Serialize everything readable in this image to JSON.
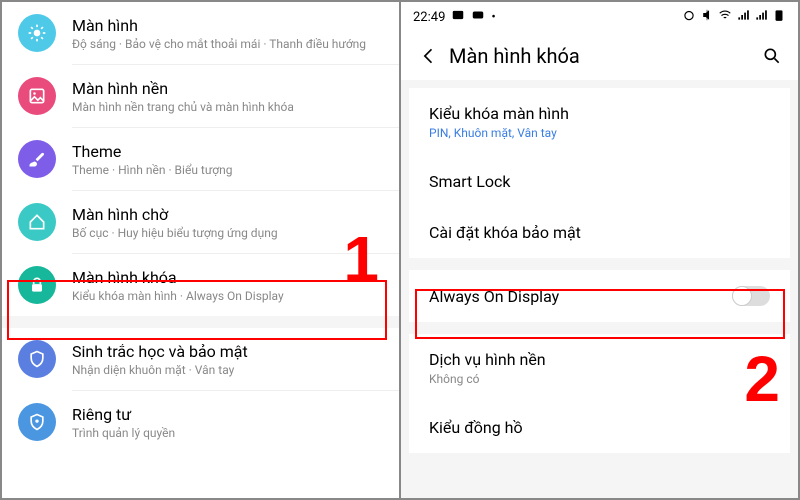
{
  "left": {
    "items": [
      {
        "title": "Màn hình",
        "sub": "Độ sáng · Bảo vệ cho mắt thoải mái · Thanh điều hướng",
        "iconColor": "#4EC9E8"
      },
      {
        "title": "Màn hình nền",
        "sub": "Màn hình nền trang chủ và màn hình khóa",
        "iconColor": "#E84B7C"
      },
      {
        "title": "Theme",
        "sub": "Theme · Hình nền · Biểu tượng",
        "iconColor": "#7E5DE8"
      },
      {
        "title": "Màn hình chờ",
        "sub": "Bố cục · Huy hiệu biểu tượng ứng dụng",
        "iconColor": "#3AC9C4"
      },
      {
        "title": "Màn hình khóa",
        "sub": "Kiểu khóa màn hình · Always On Display",
        "iconColor": "#16B79A"
      },
      {
        "title": "Sinh trắc học và bảo mật",
        "sub": "Nhận diện khuôn mặt · Vân tay",
        "iconColor": "#5A7FE0"
      },
      {
        "title": "Riêng tư",
        "sub": "Trình quản lý quyền",
        "iconColor": "#4A96E0"
      }
    ]
  },
  "right": {
    "status": {
      "time": "22:49"
    },
    "header": "Màn hình khóa",
    "group1": [
      {
        "title": "Kiểu khóa màn hình",
        "sub": "PIN, Khuôn mặt, Vân tay",
        "blue": true
      },
      {
        "title": "Smart Lock"
      },
      {
        "title": "Cài đặt khóa bảo mật"
      }
    ],
    "aod": {
      "title": "Always On Display"
    },
    "group2": [
      {
        "title": "Dịch vụ hình nền",
        "sub": "Không có"
      },
      {
        "title": "Kiểu đồng hồ"
      }
    ]
  },
  "annotations": {
    "num1": "1",
    "num2": "2"
  }
}
